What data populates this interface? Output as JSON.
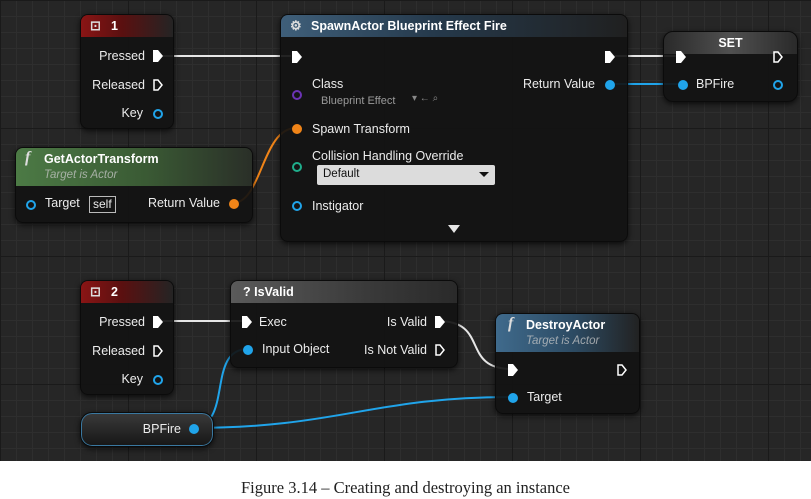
{
  "colors": {
    "exec": "#ffffff",
    "object_pin": "#20a4ea",
    "struct_pin": "#f08418",
    "class_pin": "#6b33b5",
    "enum_pin": "#1fae8c"
  },
  "input_event_1": {
    "icon": "key-event-icon",
    "title": "1",
    "pins": [
      "Pressed",
      "Released",
      "Key"
    ]
  },
  "input_event_2": {
    "icon": "key-event-icon",
    "title": "2",
    "pins": [
      "Pressed",
      "Released",
      "Key"
    ]
  },
  "spawn_actor": {
    "icon": "spawn-icon",
    "title": "SpawnActor Blueprint Effect Fire",
    "class_label": "Class",
    "class_value": "Blueprint Effect",
    "return_label": "Return Value",
    "spawn_transform_label": "Spawn Transform",
    "collision_label": "Collision Handling Override",
    "collision_value": "Default",
    "instigator_label": "Instigator"
  },
  "get_actor_transform": {
    "icon": "function-icon",
    "title": "GetActorTransform",
    "subtitle": "Target is Actor",
    "target_label": "Target",
    "target_value": "self",
    "return_label": "Return Value"
  },
  "set_node": {
    "title": "SET",
    "var_label": "BPFire"
  },
  "is_valid": {
    "icon": "question-icon",
    "title": "? IsValid",
    "exec_label": "Exec",
    "input_label": "Input Object",
    "is_valid_label": "Is Valid",
    "is_not_valid_label": "Is Not Valid"
  },
  "destroy_actor": {
    "icon": "function-icon",
    "title": "DestroyActor",
    "subtitle": "Target is Actor",
    "target_label": "Target"
  },
  "bpfire_getter": {
    "label": "BPFire"
  },
  "caption": "Figure 3.14 – Creating and destroying an instance"
}
